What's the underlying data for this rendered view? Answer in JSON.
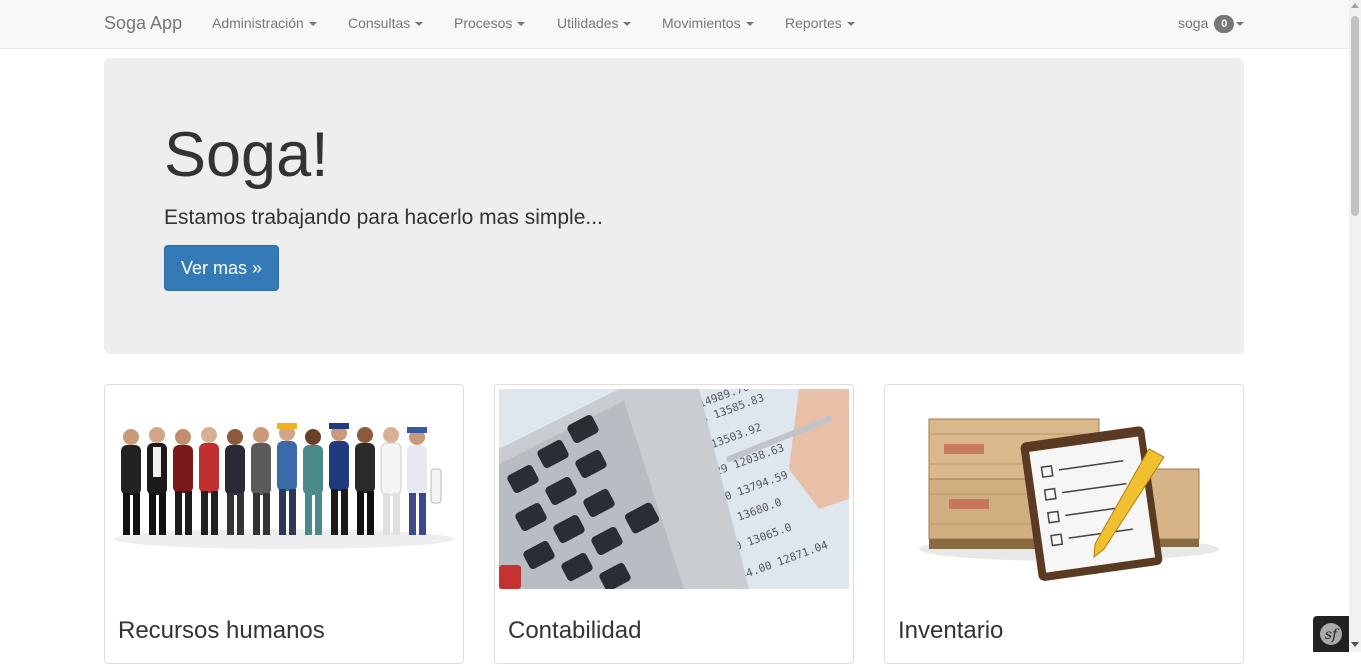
{
  "navbar": {
    "brand": "Soga App",
    "menus": [
      {
        "label": "Administración"
      },
      {
        "label": "Consultas"
      },
      {
        "label": "Procesos"
      },
      {
        "label": "Utilidades"
      },
      {
        "label": "Movimientos"
      },
      {
        "label": "Reportes"
      }
    ],
    "user": {
      "name": "soga",
      "badge": "0"
    }
  },
  "jumbotron": {
    "title": "Soga!",
    "subtitle": "Estamos trabajando para hacerlo mas simple...",
    "button_label": "Ver mas »"
  },
  "cards": [
    {
      "title": "Recursos humanos",
      "image": "workers-group-image"
    },
    {
      "title": "Contabilidad",
      "image": "calculator-image"
    },
    {
      "title": "Inventario",
      "image": "inventory-crates-image"
    }
  ],
  "colors": {
    "primary": "#337ab7",
    "navbar_bg": "#f8f8f8",
    "jumbotron_bg": "#eeeeee"
  },
  "icons": {
    "symfony_toolbar": "symfony-icon"
  }
}
